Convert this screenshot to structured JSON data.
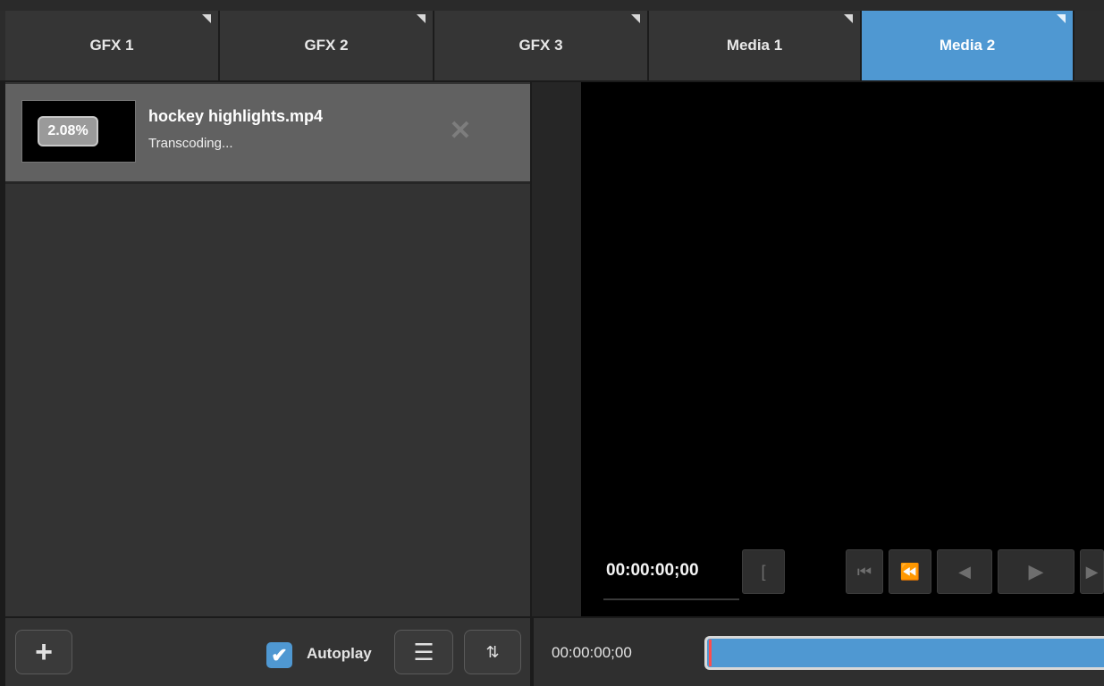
{
  "tabs": [
    {
      "label": "GFX 1",
      "active": false
    },
    {
      "label": "GFX 2",
      "active": false
    },
    {
      "label": "GFX 3",
      "active": false
    },
    {
      "label": "Media 1",
      "active": false
    },
    {
      "label": "Media 2",
      "active": true
    }
  ],
  "media_list": {
    "items": [
      {
        "name": "hockey highlights.mp4",
        "status": "Transcoding...",
        "progress_label": "2.08%",
        "progress": 0.0208
      }
    ]
  },
  "preview": {
    "timecode": "00:00:00;00"
  },
  "bottom_bar": {
    "add_label": "+",
    "autoplay_label": "Autoplay",
    "autoplay_checked": true,
    "timeline_timecode": "00:00:00;00"
  },
  "colors": {
    "accent": "#4f98d2",
    "playhead": "#ff4d4d"
  }
}
